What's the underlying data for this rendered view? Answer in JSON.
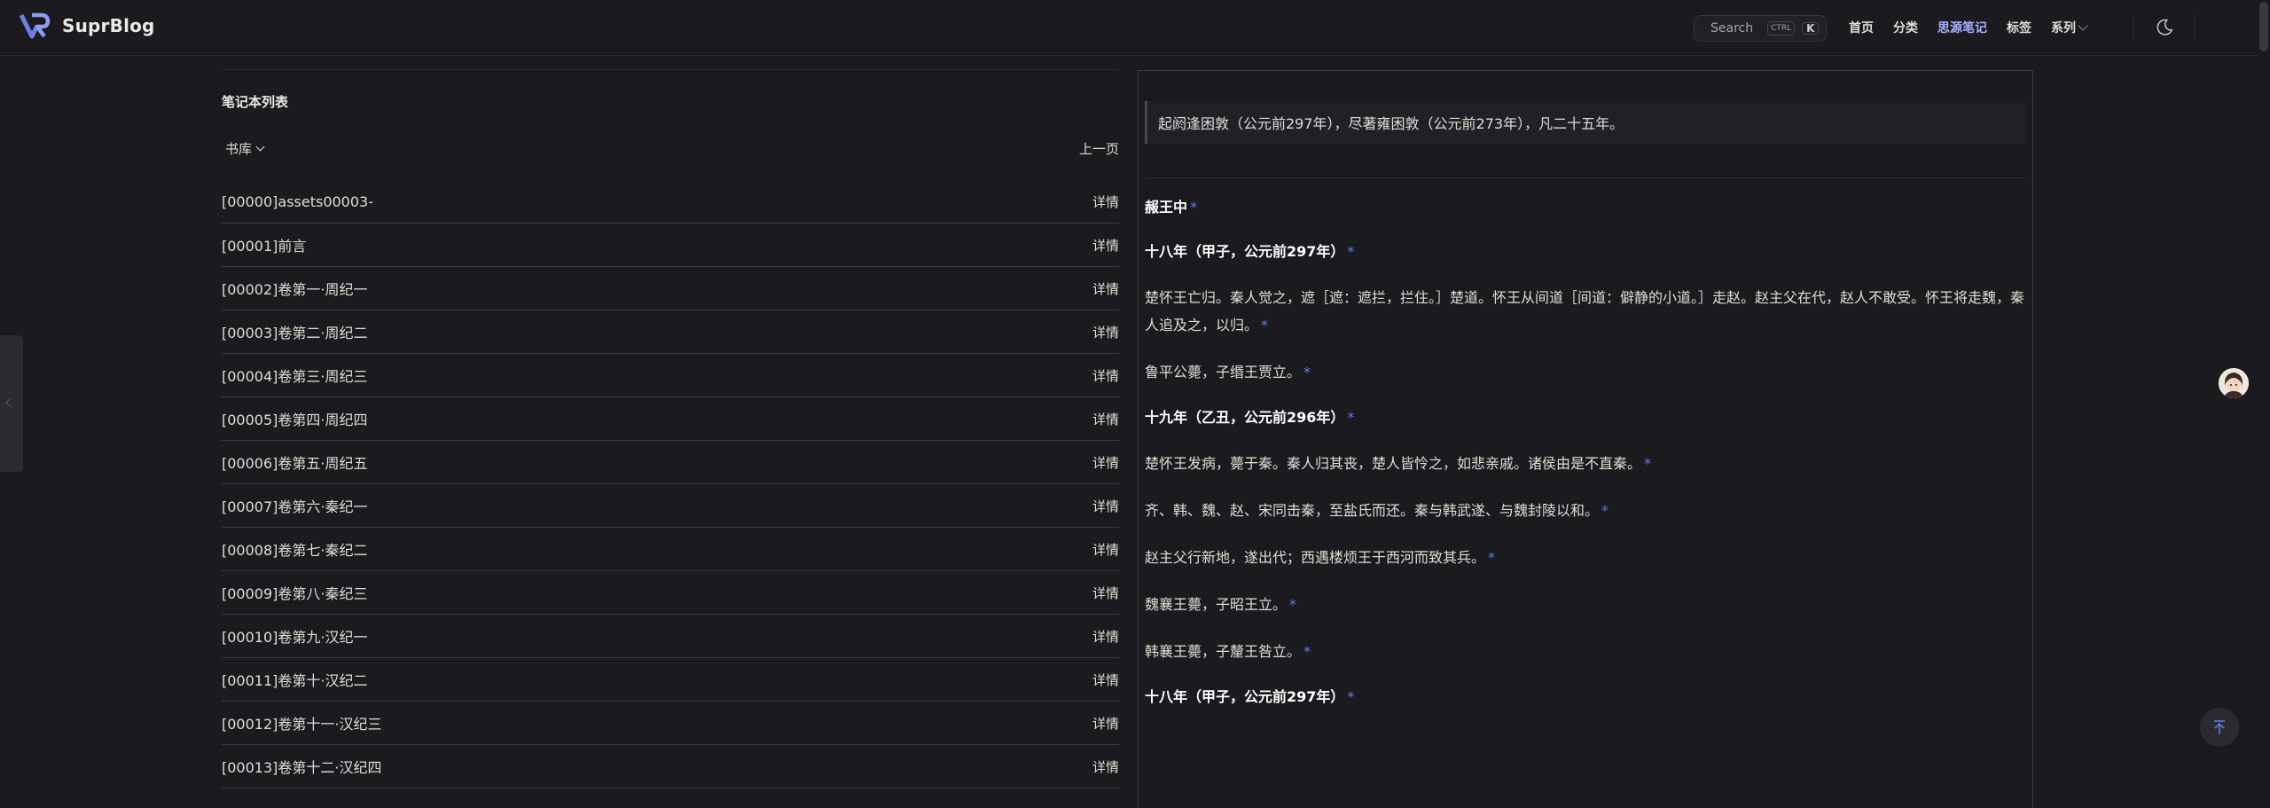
{
  "brand": {
    "name": "SuprBlog"
  },
  "search": {
    "label": "Search",
    "kbd_ctrl": "CTRL",
    "kbd_key": "K"
  },
  "nav": {
    "items": [
      "首页",
      "分类",
      "思源笔记",
      "标签",
      "系列"
    ],
    "active_index": 2
  },
  "colors": {
    "accent": "#a8b1ff",
    "background": "#1b1b1f",
    "link_star": "#5d7be8"
  },
  "icons": {
    "theme": "moon-icon",
    "back_to_top": "arrow-up-icon",
    "search": "search-icon"
  },
  "left": {
    "title": "笔记本列表",
    "library_label": "书库",
    "prev_label": "上一页",
    "detail_label": "详情",
    "rows": [
      "[00000]assets00003-",
      "[00001]前言",
      "[00002]卷第一·周纪一",
      "[00003]卷第二·周纪二",
      "[00004]卷第三·周纪三",
      "[00005]卷第四·周纪四",
      "[00006]卷第五·周纪五",
      "[00007]卷第六·秦纪一",
      "[00008]卷第七·秦纪二",
      "[00009]卷第八·秦纪三",
      "[00010]卷第九·汉纪一",
      "[00011]卷第十·汉纪二",
      "[00012]卷第十一·汉纪三",
      "[00013]卷第十二·汉纪四"
    ]
  },
  "right": {
    "quote": "起阏逢困敦（公元前297年），尽著雍困敦（公元前273年），凡二十五年。",
    "star": "*",
    "blocks": [
      {
        "type": "h",
        "text": "赧王中"
      },
      {
        "type": "h",
        "text": "十八年（甲子，公元前297年）"
      },
      {
        "type": "p",
        "text": "楚怀王亡归。秦人觉之，遮［遮：遮拦，拦住。］楚道。怀王从间道［间道：僻静的小道。］走赵。赵主父在代，赵人不敢受。怀王将走魏，秦人追及之，以归。"
      },
      {
        "type": "p",
        "text": "鲁平公薨，子缗王贾立。"
      },
      {
        "type": "h",
        "text": "十九年（乙丑，公元前296年）"
      },
      {
        "type": "p",
        "text": "楚怀王发病，薨于秦。秦人归其丧，楚人皆怜之，如悲亲戚。诸侯由是不直秦。"
      },
      {
        "type": "p",
        "text": "齐、韩、魏、赵、宋同击秦，至盐氏而还。秦与韩武遂、与魏封陵以和。"
      },
      {
        "type": "p",
        "text": "赵主父行新地，遂出代；西遇楼烦王于西河而致其兵。"
      },
      {
        "type": "p",
        "text": "魏襄王薨，子昭王立。"
      },
      {
        "type": "p",
        "text": "韩襄王薨，子釐王咎立。"
      },
      {
        "type": "h",
        "text": "十八年（甲子，公元前297年）"
      }
    ]
  }
}
